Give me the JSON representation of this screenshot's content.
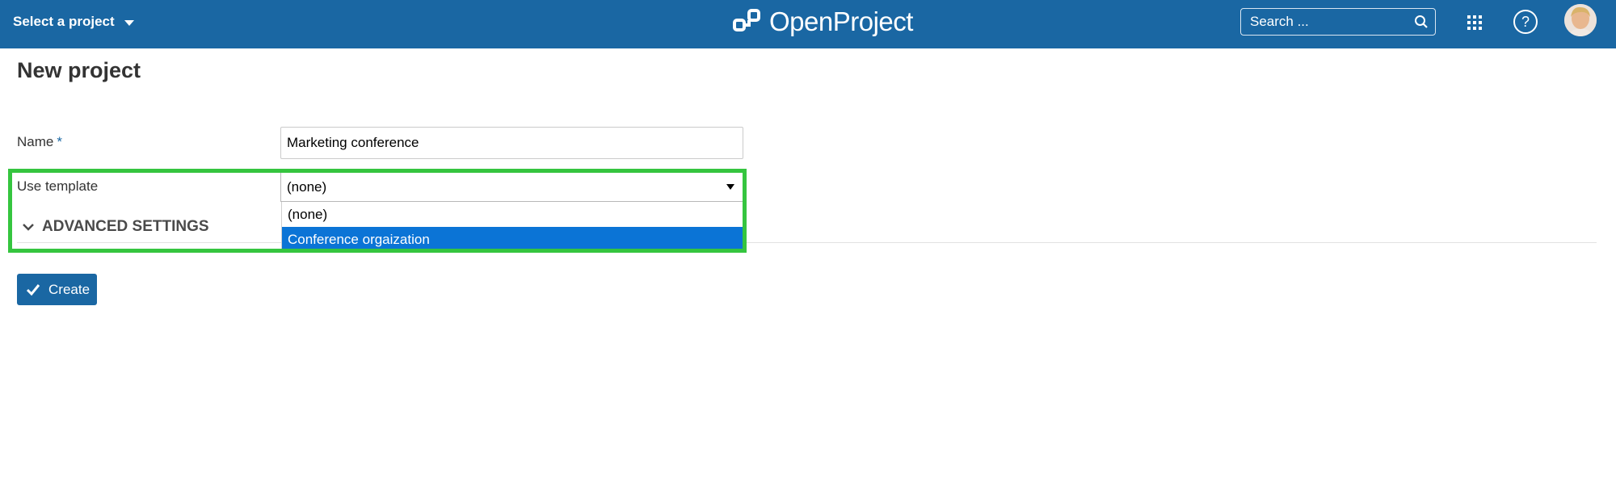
{
  "header": {
    "project_selector": "Select a project",
    "logo_text": "OpenProject",
    "search_placeholder": "Search ...",
    "icons": [
      "chevron-down-icon",
      "logo-icon",
      "search-icon",
      "modules-grid-icon",
      "help-icon",
      "avatar"
    ]
  },
  "page": {
    "title": "New project"
  },
  "form": {
    "name_label": "Name",
    "required_mark": "*",
    "name_value": "Marketing conference",
    "template_label": "Use template",
    "template_selected": "(none)",
    "template_options": [
      "(none)",
      "Conference orgaization"
    ],
    "highlighted_option": "Conference orgaization",
    "advanced_label": "ADVANCED SETTINGS",
    "create_label": "Create"
  },
  "colors": {
    "header_bg": "#1a67a3",
    "highlight_frame": "#35c53f",
    "option_selected": "#0b74d6"
  }
}
